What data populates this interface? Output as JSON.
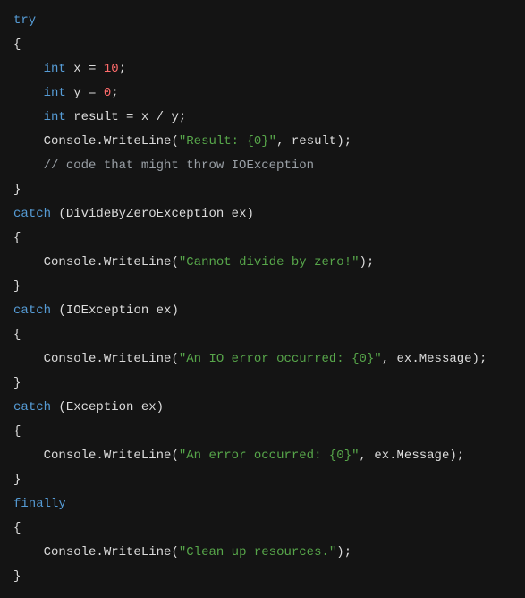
{
  "tokens": {
    "kw_try": "try",
    "kw_catch": "catch",
    "kw_finally": "finally",
    "kw_int": "int",
    "var_x": "x",
    "var_y": "y",
    "var_result": "result",
    "var_ex": "ex",
    "num_10": "10",
    "num_0": "0",
    "cls_console": "Console",
    "m_writeline": "WriteLine",
    "prop_message": "Message",
    "type_dbz": "DivideByZeroException",
    "type_ioe": "IOException",
    "type_exc": "Exception",
    "str_result": "\"Result: {0}\"",
    "str_divzero": "\"Cannot divide by zero!\"",
    "str_ioerr": "\"An IO error occurred: {0}\"",
    "str_err": "\"An error occurred: {0}\"",
    "str_cleanup": "\"Clean up resources.\"",
    "comment_io": "// code that might throw IOException",
    "brace_open": "{",
    "brace_close": "}",
    "paren_open": "(",
    "paren_close": ")",
    "eq": " = ",
    "div": " / ",
    "semi": ";",
    "comma": ", ",
    "dot": "."
  }
}
